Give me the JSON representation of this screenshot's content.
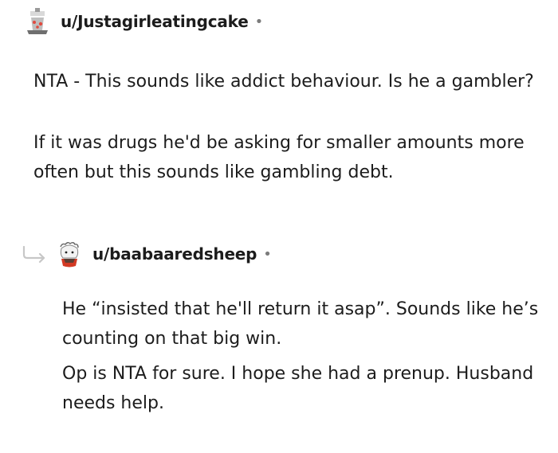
{
  "comments": [
    {
      "username": "u/Justagirleatingcake",
      "separator": "•",
      "paragraphs": [
        "NTA - This sounds like addict behaviour. Is he a gambler?",
        "If it was drugs he'd be asking for smaller amounts more often but this sounds like gambling debt."
      ]
    },
    {
      "username": "u/baabaaredsheep",
      "separator": "•",
      "paragraphs": [
        "He “insisted that he'll return it asap”. Sounds like he’s counting on that big win.",
        "Op is NTA for sure. I hope she had a prenup. Husband needs help."
      ]
    }
  ],
  "icons": {
    "reply_arrow": "reply-arrow-icon",
    "avatar_1": "avatar-illustration",
    "avatar_2": "avatar-illustration"
  },
  "colors": {
    "text": "#1c1c1c",
    "muted": "#7c7c7c",
    "reply_line": "#c7c7c7"
  }
}
